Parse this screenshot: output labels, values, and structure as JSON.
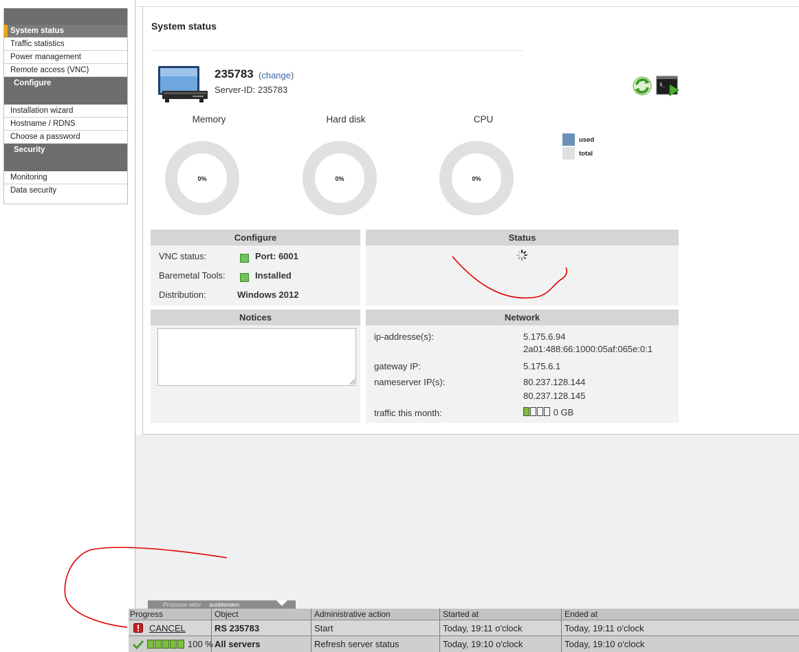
{
  "sidebar": {
    "items": [
      {
        "label": "System status",
        "active": true
      },
      {
        "label": "Traffic statistics"
      },
      {
        "label": "Power management"
      },
      {
        "label": "Remote access (VNC)"
      }
    ],
    "group_configure": "Configure",
    "configure_items": [
      {
        "label": "Installation wizard"
      },
      {
        "label": "Hostname / RDNS"
      },
      {
        "label": "Choose a password"
      }
    ],
    "group_security": "Security",
    "security_items": [
      {
        "label": "Monitoring"
      },
      {
        "label": "Data security"
      }
    ]
  },
  "page": {
    "title": "System status"
  },
  "server": {
    "name": "235783",
    "change_open": "(",
    "change_label": "change",
    "change_close": ")",
    "id_label": "Server-ID: 235783"
  },
  "gauges": [
    {
      "label": "Memory",
      "percent_text": "0%",
      "used_fraction": 0
    },
    {
      "label": "Hard disk",
      "percent_text": "0%",
      "used_fraction": 0
    },
    {
      "label": "CPU",
      "percent_text": "0%",
      "used_fraction": 0
    }
  ],
  "legend": {
    "used": "used",
    "total": "total",
    "used_color": "#6a92b8",
    "total_color": "#e0e0e0"
  },
  "configure_box": {
    "title": "Configure",
    "rows": [
      {
        "label": "VNC status:",
        "value": "Port: 6001",
        "indicator": "green"
      },
      {
        "label": "Baremetal Tools:",
        "value": "Installed",
        "indicator": "green"
      },
      {
        "label": "Distribution:",
        "value": "Windows 2012"
      }
    ]
  },
  "status_box": {
    "title": "Status"
  },
  "notices_box": {
    "title": "Notices",
    "text": ""
  },
  "network_box": {
    "title": "Network",
    "ip_label": "ip-addresse(s):",
    "ip_v4": "5.175.6.94",
    "ip_v6": "2a01:488:66:1000:05af:065e:0:1",
    "gateway_label": "gateway IP:",
    "gateway_value": "5.175.6.1",
    "ns_label": "nameserver IP(s):",
    "ns1": "80.237.128.144",
    "ns2": "80.237.128.145",
    "traffic_label": "traffic this month:",
    "traffic_value": "0 GB",
    "traffic_fraction": 0.25
  },
  "process_bar": {
    "tab_label": "Prozesse aktiv",
    "tab_hide": "ausblenden",
    "headers": [
      "Progress",
      "Object",
      "Administrative action",
      "Started at",
      "Ended at"
    ],
    "rows": [
      {
        "progress": "CANCEL",
        "object": "RS 235783",
        "action": "Start",
        "started": "Today, 19:11 o'clock",
        "ended": "Today, 19:11 o'clock"
      },
      {
        "progress": "100 %",
        "progress_fraction": 1.0,
        "object": "All servers",
        "action": "Refresh server status",
        "started": "Today, 19:10 o'clock",
        "ended": "Today, 19:10 o'clock"
      }
    ]
  },
  "colors": {
    "sidebar_header": "#6d6d6d",
    "active_accent": "#f0a500",
    "link": "#3a6aa8",
    "box_header": "#d5d5d5",
    "indicator_green": "#6fc35a",
    "annotation_red": "#e00000"
  }
}
